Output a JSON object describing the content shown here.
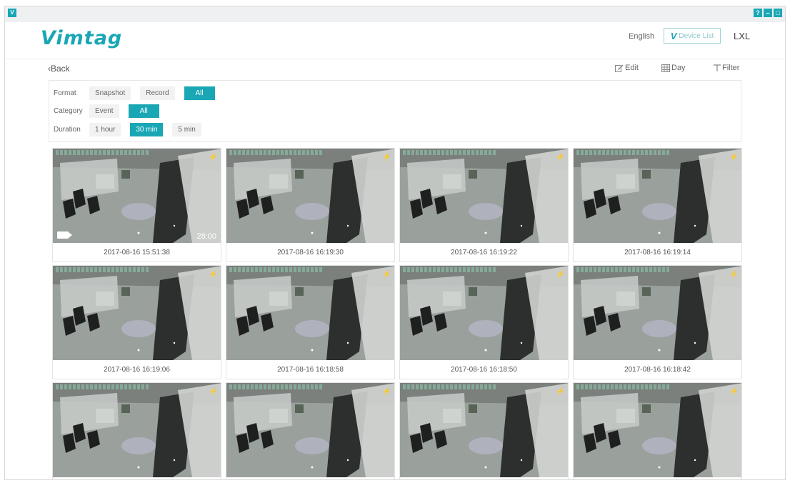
{
  "window": {
    "app_icon": "app-icon",
    "controls": [
      "?",
      "–",
      "□"
    ]
  },
  "header": {
    "logo": "Vimtag",
    "language": "English",
    "device_list": "Device List",
    "user": "LXL"
  },
  "toolbar": {
    "back": "‹Back",
    "edit": "Edit",
    "day": "Day",
    "filter": "Filter"
  },
  "filters": {
    "format": {
      "label": "Format",
      "options": [
        "Snapshot",
        "Record",
        "All"
      ],
      "selected": "All"
    },
    "category": {
      "label": "Category",
      "options": [
        "Event",
        "All"
      ],
      "selected": "All"
    },
    "duration": {
      "label": "Duration",
      "options": [
        "1 hour",
        "30 min",
        "5 min"
      ],
      "selected": "30 min"
    }
  },
  "colors": {
    "accent": "#1aa7b5"
  },
  "recordings": [
    {
      "timestamp": "2017-08-16 15:51:38",
      "duration": "28:00",
      "is_video": true,
      "motion_event": true
    },
    {
      "timestamp": "2017-08-16 16:19:30",
      "motion_event": true
    },
    {
      "timestamp": "2017-08-16 16:19:22",
      "motion_event": true
    },
    {
      "timestamp": "2017-08-16 16:19:14",
      "motion_event": true
    },
    {
      "timestamp": "2017-08-16 16:19:06",
      "motion_event": true
    },
    {
      "timestamp": "2017-08-16 16:18:58",
      "motion_event": true
    },
    {
      "timestamp": "2017-08-16 16:18:50",
      "motion_event": true
    },
    {
      "timestamp": "2017-08-16 16:18:42",
      "motion_event": true
    },
    {
      "timestamp": "",
      "motion_event": true
    },
    {
      "timestamp": "",
      "motion_event": true
    },
    {
      "timestamp": "",
      "motion_event": true
    },
    {
      "timestamp": "",
      "motion_event": true
    }
  ]
}
